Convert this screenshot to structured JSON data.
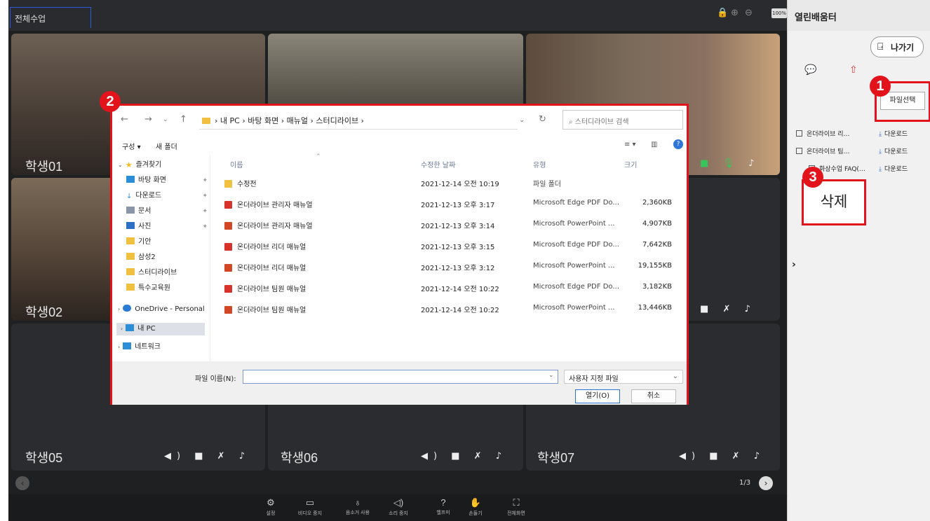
{
  "top": {
    "tab_label": "전체수업",
    "zoom": "100%"
  },
  "tiles": [
    {
      "name": "학생01"
    },
    {
      "name": "학생02"
    },
    {
      "name": "학생05"
    },
    {
      "name": "학생06"
    },
    {
      "name": "학생07"
    }
  ],
  "pager": {
    "text": "1/3"
  },
  "bottombar": [
    {
      "label": "설정",
      "icon": "settings-icon"
    },
    {
      "label": "비디오 중지",
      "icon": "video-icon"
    },
    {
      "label": "음소거 사용",
      "icon": "mic-icon"
    },
    {
      "label": "소리 중지",
      "icon": "speaker-icon"
    },
    {
      "label": "헬프미",
      "icon": "help-icon"
    },
    {
      "label": "손들기",
      "icon": "hand-icon"
    },
    {
      "label": "전체화면",
      "icon": "fullscreen-icon"
    }
  ],
  "panel": {
    "title": "열린배움터",
    "exit": "나가기",
    "file_select": "파일선택",
    "files": [
      {
        "name": "온더라이브 리…",
        "action": "다운로드"
      },
      {
        "name": "온더라이브 팀…",
        "action": "다운로드"
      },
      {
        "name": "화상수업 FAQ(…",
        "action": "다운로드"
      }
    ],
    "delete": "삭제"
  },
  "badges": [
    "1",
    "2",
    "3"
  ],
  "dialog": {
    "path": "› 내 PC › 바탕 화면 › 매뉴얼 › 스터디라이브 ›",
    "search_placeholder": "스터디라이브 검색",
    "organize": "구성 ▾",
    "new_folder": "새 폴더",
    "nav": [
      {
        "label": "즐겨찾기",
        "color": "#f3b81b"
      },
      {
        "label": "바탕 화면",
        "color": "#2d8ed8"
      },
      {
        "label": "다운로드",
        "color": "#2d8ed8"
      },
      {
        "label": "문서",
        "color": "#8a96a8"
      },
      {
        "label": "사진",
        "color": "#2d6fc4"
      },
      {
        "label": "기안",
        "color": "#f0c040"
      },
      {
        "label": "삼성2",
        "color": "#f0c040"
      },
      {
        "label": "스터디라이브",
        "color": "#f0c040"
      },
      {
        "label": "특수교육원",
        "color": "#f0c040"
      },
      {
        "label": "OneDrive - Personal",
        "color": "#2a7bd4"
      },
      {
        "label": "내 PC",
        "color": "#2d8ed8"
      },
      {
        "label": "네트워크",
        "color": "#2d8ed8"
      }
    ],
    "columns": {
      "name": "이름",
      "date": "수정한 날짜",
      "type": "유형",
      "size": "크기"
    },
    "files": [
      {
        "name": "수정전",
        "date": "2021-12-14 오전 10:19",
        "type": "파일 폴더",
        "size": "",
        "color": "#f0c040"
      },
      {
        "name": "온더라이브 관리자 매뉴얼",
        "date": "2021-12-13 오후 3:17",
        "type": "Microsoft Edge PDF Do...",
        "size": "2,360KB",
        "color": "#d8332a"
      },
      {
        "name": "온더라이브 관리자 매뉴얼",
        "date": "2021-12-13 오후 3:14",
        "type": "Microsoft PowerPoint ...",
        "size": "4,907KB",
        "color": "#d24726"
      },
      {
        "name": "온더라이브 리더 매뉴얼",
        "date": "2021-12-13 오후 3:15",
        "type": "Microsoft Edge PDF Do...",
        "size": "7,642KB",
        "color": "#d8332a"
      },
      {
        "name": "온더라이브 리더 매뉴얼",
        "date": "2021-12-13 오후 3:12",
        "type": "Microsoft PowerPoint ...",
        "size": "19,155KB",
        "color": "#d24726"
      },
      {
        "name": "온더라이브 팀원 매뉴얼",
        "date": "2021-12-14 오전 10:22",
        "type": "Microsoft Edge PDF Do...",
        "size": "3,182KB",
        "color": "#d8332a"
      },
      {
        "name": "온더라이브 팀원 매뉴얼",
        "date": "2021-12-14 오전 10:22",
        "type": "Microsoft PowerPoint ...",
        "size": "13,446KB",
        "color": "#d24726"
      }
    ],
    "filename_label": "파일 이름(N):",
    "filename_value": "",
    "filetype": "사용자 지정 파일",
    "open": "열기(O)",
    "cancel": "취소"
  }
}
